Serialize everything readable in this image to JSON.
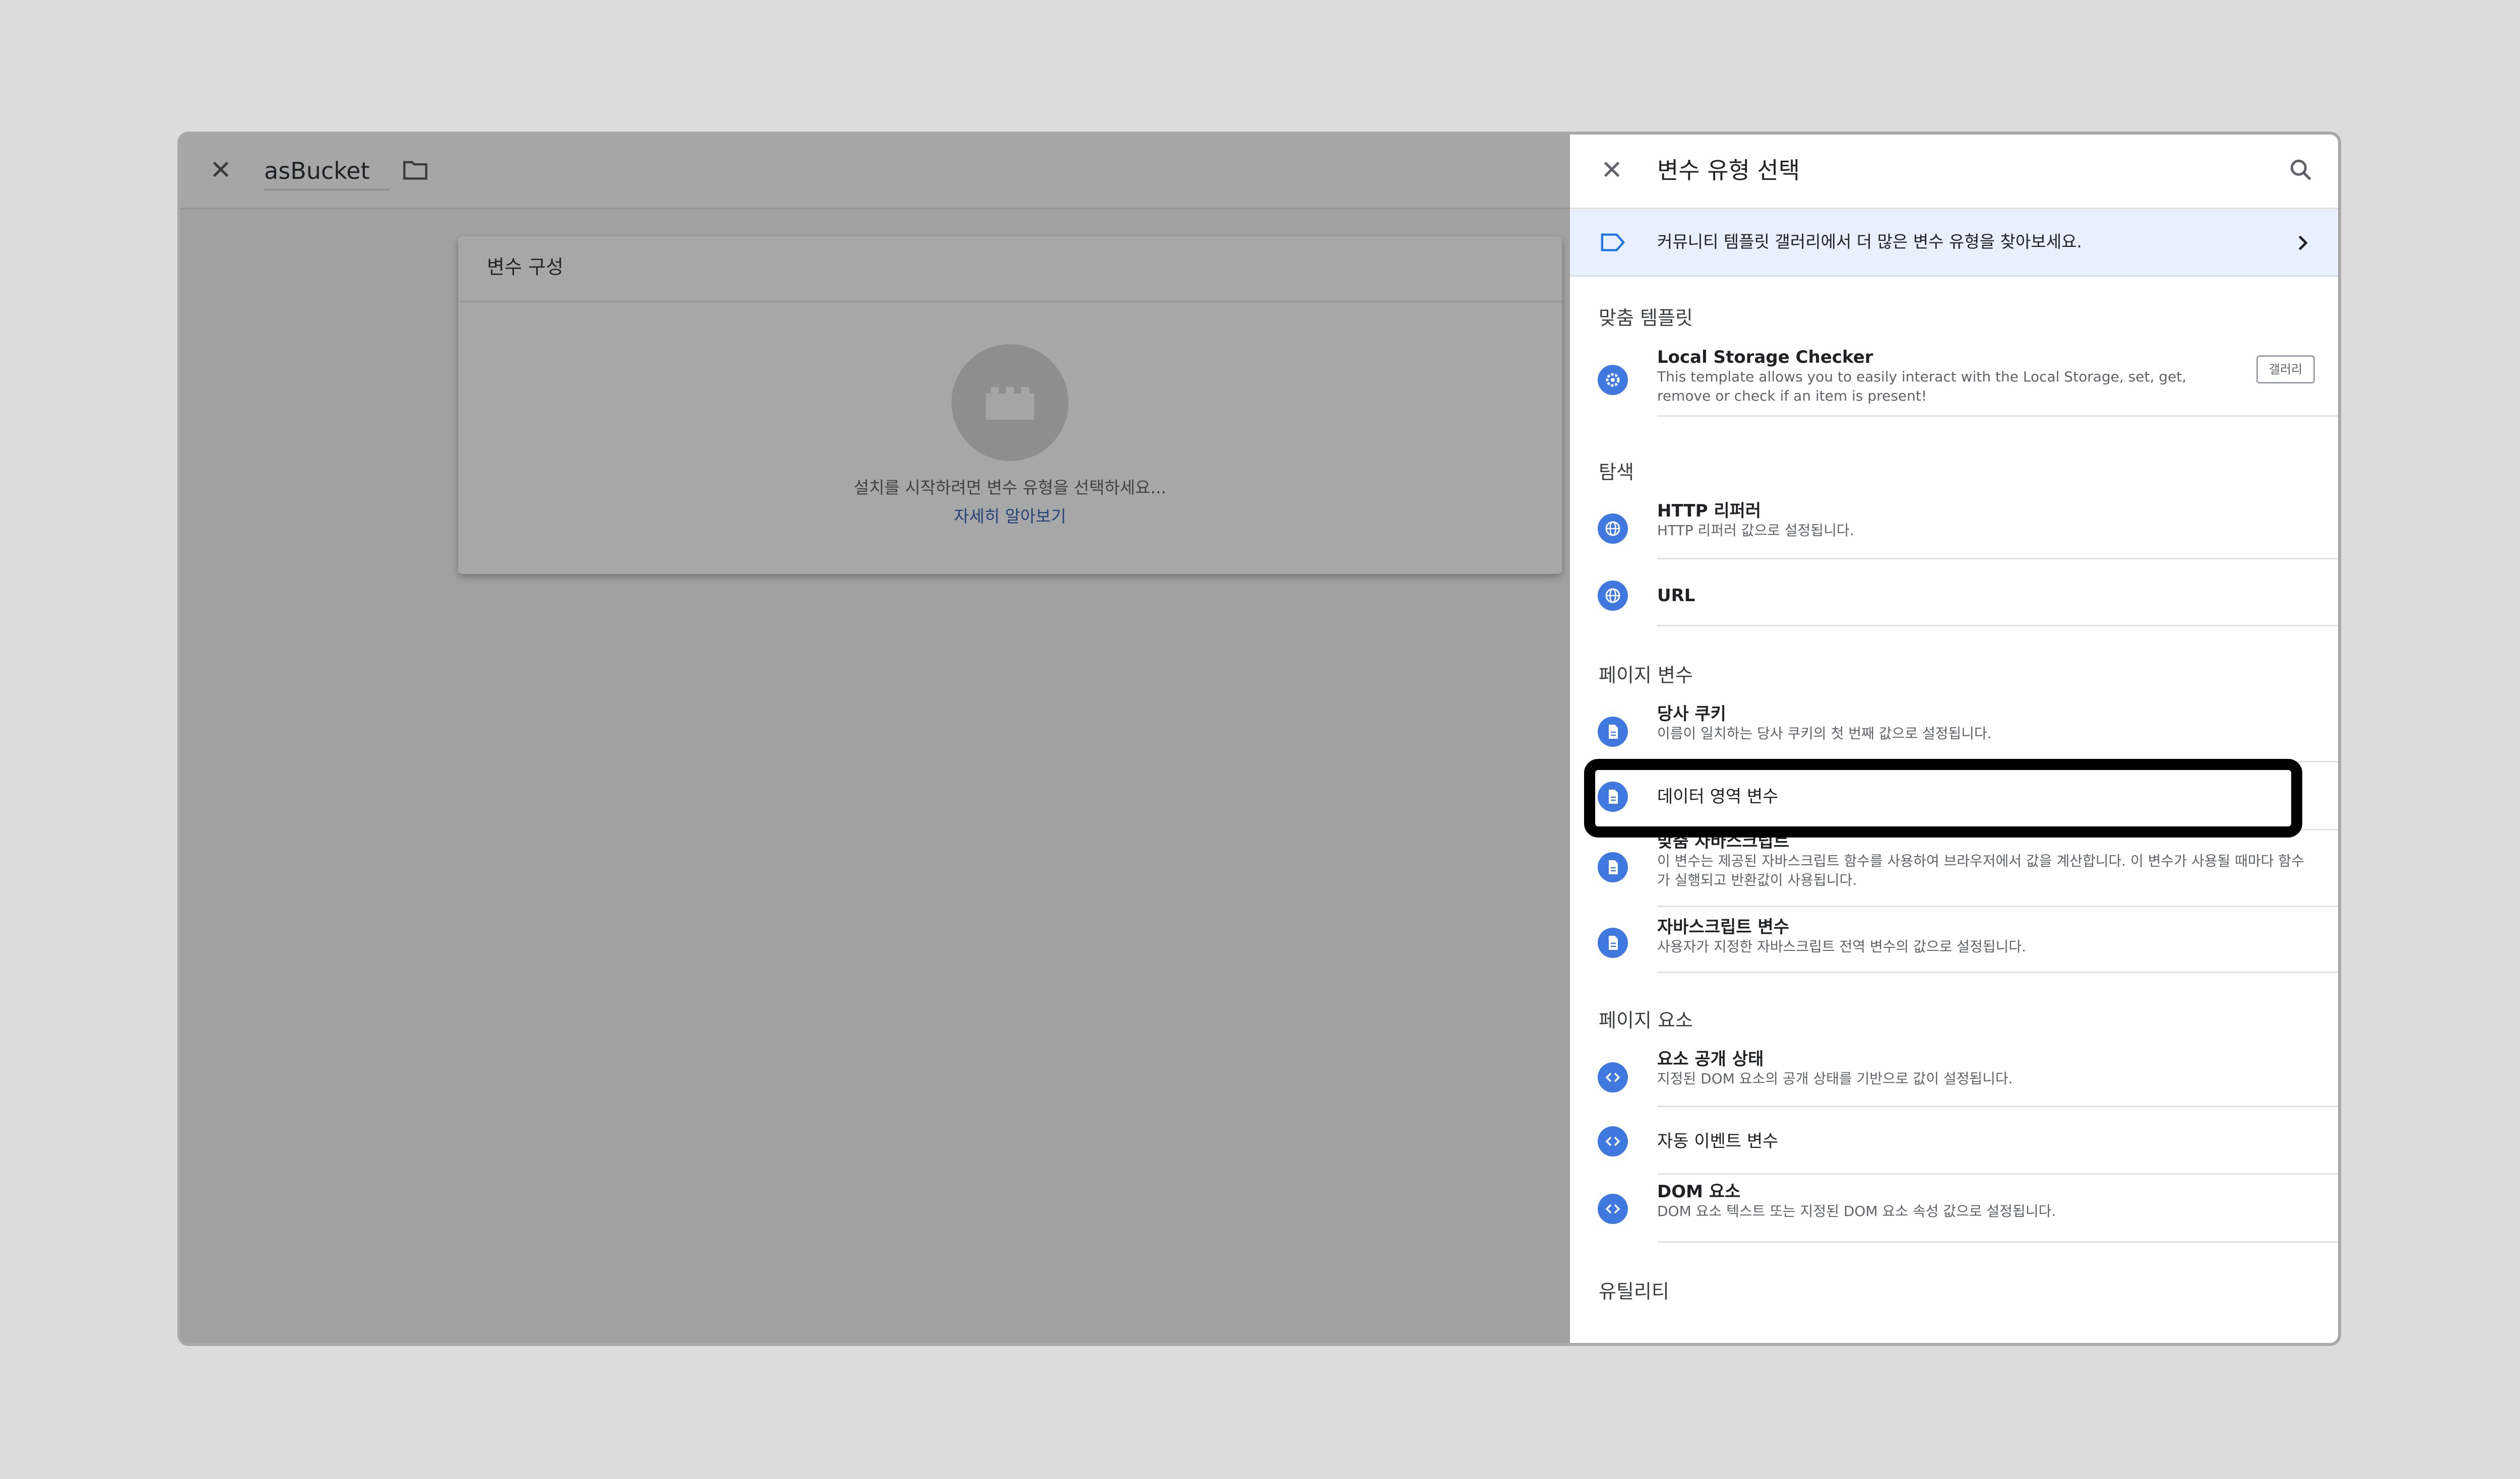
{
  "editor": {
    "name": "asBucket",
    "config_title": "변수 구성",
    "prompt": "설치를 시작하려면 변수 유형을 선택하세요...",
    "learn_more": "자세히 알아보기"
  },
  "panel": {
    "title": "변수 유형 선택",
    "banner_text": "커뮤니티 템플릿 갤러리에서 더 많은 변수 유형을 찾아보세요.",
    "sections": [
      {
        "label": "맞춤 템플릿",
        "items": [
          {
            "title": "Local Storage Checker",
            "desc": "This template allows you to easily interact with the Local Storage, set, get, remove or check if an item is present!",
            "button": "갤러리",
            "icon": "gear-icon"
          }
        ]
      },
      {
        "label": "탐색",
        "items": [
          {
            "title": "HTTP 리퍼러",
            "desc": "HTTP 리퍼러 값으로 설정됩니다.",
            "icon": "globe-icon"
          },
          {
            "title": "URL",
            "desc": "",
            "icon": "globe-icon"
          }
        ]
      },
      {
        "label": "페이지 변수",
        "items": [
          {
            "title": "당사 쿠키",
            "desc": "이름이 일치하는 당사 쿠키의 첫 번째 값으로 설정됩니다.",
            "icon": "document-icon"
          },
          {
            "title": "데이터 영역 변수",
            "desc": "",
            "icon": "document-icon"
          },
          {
            "title": "맞춤 자바스크립트",
            "desc": "이 변수는 제공된 자바스크립트 함수를 사용하여 브라우저에서 값을 계산합니다. 이 변수가 사용될 때마다 함수가 실행되고 반환값이 사용됩니다.",
            "icon": "document-icon"
          },
          {
            "title": "자바스크립트 변수",
            "desc": "사용자가 지정한 자바스크립트 전역 변수의 값으로 설정됩니다.",
            "icon": "document-icon"
          }
        ]
      },
      {
        "label": "페이지 요소",
        "items": [
          {
            "title": "요소 공개 상태",
            "desc": "지정된 DOM 요소의 공개 상태를 기반으로 값이 설정됩니다.",
            "icon": "code-icon"
          },
          {
            "title": "자동 이벤트 변수",
            "desc": "",
            "icon": "code-icon"
          },
          {
            "title": "DOM 요소",
            "desc": "DOM 요소 텍스트 또는 지정된 DOM 요소 속성 값으로 설정됩니다.",
            "icon": "code-icon"
          }
        ]
      },
      {
        "label": "유틸리티",
        "items": []
      }
    ]
  },
  "colors": {
    "accent": "#3f79e0",
    "banner_bg": "#e8f0fe",
    "highlight_border": "#000000",
    "overlay": "#a1a1a2"
  }
}
